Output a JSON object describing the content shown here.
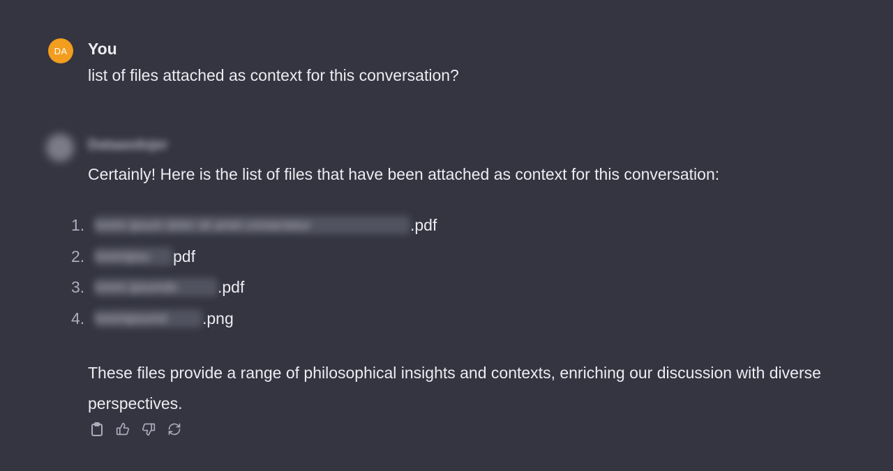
{
  "user": {
    "avatar_initials": "DA",
    "avatar_color": "#f29d1e",
    "name": "You",
    "message": "list of files attached as context for this conversation?"
  },
  "assistant": {
    "intro": "Certainly! Here is the list of files that have been attached as context for this conversation:",
    "files": [
      {
        "number": "1.",
        "extension": ".pdf"
      },
      {
        "number": "2.",
        "extension": "pdf"
      },
      {
        "number": "3.",
        "extension": ".pdf"
      },
      {
        "number": "4.",
        "extension": ".png"
      }
    ],
    "summary": "These files provide a range of philosophical insights and contexts, enriching our discussion with diverse perspectives.",
    "actions": [
      "copy-icon",
      "thumbs-up-icon",
      "thumbs-down-icon",
      "regenerate-icon"
    ]
  },
  "colors": {
    "background": "#343541",
    "text": "#ececf1",
    "muted": "#acacbe"
  }
}
